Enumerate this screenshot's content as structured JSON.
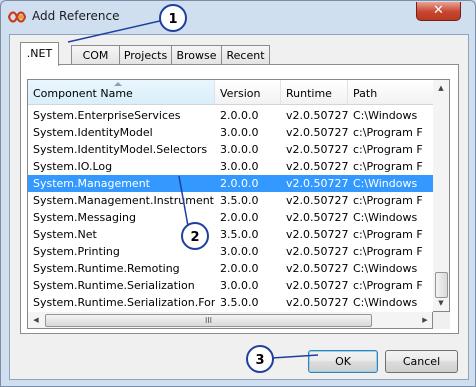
{
  "window": {
    "title": "Add Reference",
    "close_glyph": "✕"
  },
  "tabs": [
    {
      "label": ".NET",
      "active": true
    },
    {
      "label": "COM"
    },
    {
      "label": "Projects"
    },
    {
      "label": "Browse"
    },
    {
      "label": "Recent"
    }
  ],
  "list": {
    "headers": [
      "Component Name",
      "Version",
      "Runtime",
      "Path"
    ],
    "rows": [
      {
        "name": "System.EnterpriseServices",
        "version": "2.0.0.0",
        "runtime": "v2.0.50727",
        "path": "C:\\Windows"
      },
      {
        "name": "System.IdentityModel",
        "version": "3.0.0.0",
        "runtime": "v2.0.50727",
        "path": "c:\\Program F"
      },
      {
        "name": "System.IdentityModel.Selectors",
        "version": "3.0.0.0",
        "runtime": "v2.0.50727",
        "path": "c:\\Program F"
      },
      {
        "name": "System.IO.Log",
        "version": "3.0.0.0",
        "runtime": "v2.0.50727",
        "path": "c:\\Program F"
      },
      {
        "name": "System.Management",
        "version": "2.0.0.0",
        "runtime": "v2.0.50727",
        "path": "C:\\Windows",
        "selected": true
      },
      {
        "name": "System.Management.Instrument...",
        "version": "3.5.0.0",
        "runtime": "v2.0.50727",
        "path": "c:\\Program F"
      },
      {
        "name": "System.Messaging",
        "version": "2.0.0.0",
        "runtime": "v2.0.50727",
        "path": "C:\\Windows"
      },
      {
        "name": "System.Net",
        "version": "3.5.0.0",
        "runtime": "v2.0.50727",
        "path": "c:\\Program F"
      },
      {
        "name": "System.Printing",
        "version": "3.0.0.0",
        "runtime": "v2.0.50727",
        "path": "c:\\Program F"
      },
      {
        "name": "System.Runtime.Remoting",
        "version": "2.0.0.0",
        "runtime": "v2.0.50727",
        "path": "C:\\Windows"
      },
      {
        "name": "System.Runtime.Serialization",
        "version": "3.0.0.0",
        "runtime": "v2.0.50727",
        "path": "c:\\Program F"
      },
      {
        "name": "System.Runtime.Serialization.For...",
        "version": "3.5.0.0",
        "runtime": "v2.0.50727",
        "path": "C:\\Windows"
      }
    ]
  },
  "scrollbar": {
    "h_thumb_glyph": "III"
  },
  "buttons": {
    "ok": "OK",
    "cancel": "Cancel"
  },
  "annotations": {
    "callout1": "1",
    "callout2": "2",
    "callout3": "3"
  },
  "colors": {
    "selection": "#3399ff",
    "callout_stroke": "#1f3f9f",
    "callout_fill": "#ffffff"
  }
}
